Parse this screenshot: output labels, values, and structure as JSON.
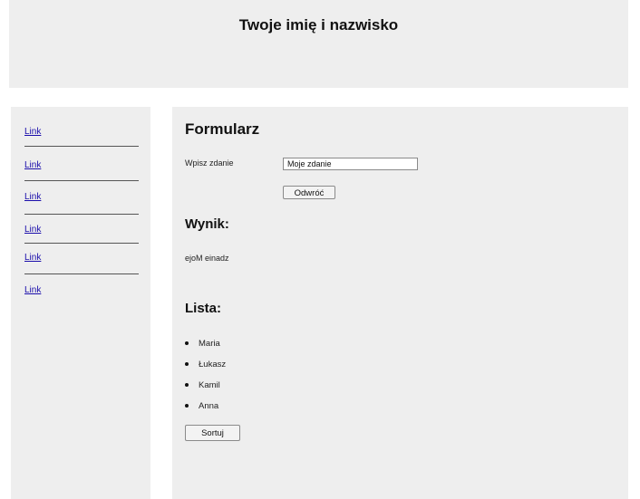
{
  "header": {
    "title": "Twoje imię i nazwisko"
  },
  "sidebar": {
    "links": [
      {
        "label": "Link"
      },
      {
        "label": "Link"
      },
      {
        "label": "Link"
      },
      {
        "label": "Link"
      },
      {
        "label": "Link"
      },
      {
        "label": "Link"
      }
    ]
  },
  "form": {
    "title": "Formularz",
    "input_label": "Wpisz zdanie",
    "input_value": "Moje zdanie",
    "reverse_button": "Odwróć"
  },
  "result": {
    "title": "Wynik:",
    "text": "ejoM einadz"
  },
  "list": {
    "title": "Lista:",
    "items": [
      "Maria",
      "Łukasz",
      "Kamil",
      "Anna"
    ],
    "sort_button": "Sortuj"
  }
}
